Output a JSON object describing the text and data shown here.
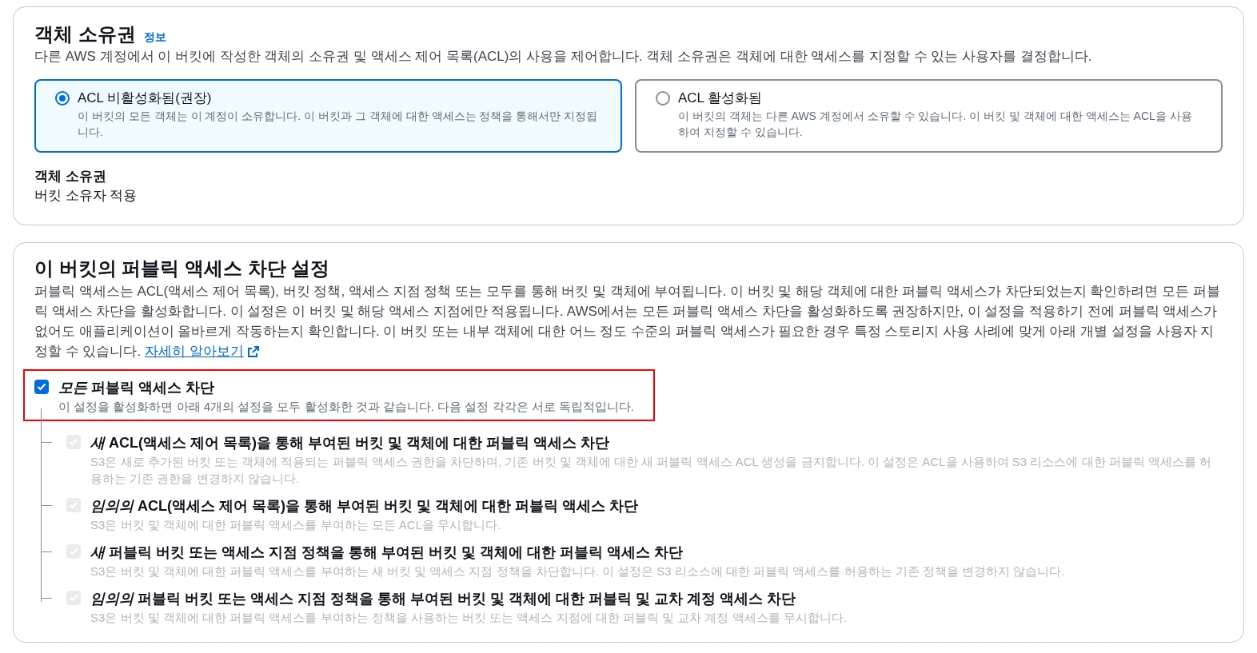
{
  "object_ownership": {
    "title": "객체 소유권",
    "info_link": "정보",
    "description": "다른 AWS 계정에서 이 버킷에 작성한 객체의 소유권 및 액세스 제어 목록(ACL)의 사용을 제어합니다. 객체 소유권은 객체에 대한 액세스를 지정할 수 있는 사용자를 결정합니다.",
    "options": [
      {
        "label": "ACL 비활성화됨(권장)",
        "description": "이 버킷의 모든 객체는 이 계정이 소유합니다. 이 버킷과 그 객체에 대한 액세스는 정책을 통해서만 지정됩니다.",
        "selected": true
      },
      {
        "label": "ACL 활성화됨",
        "description": "이 버킷의 객체는 다른 AWS 계정에서 소유할 수 있습니다. 이 버킷 및 객체에 대한 액세스는 ACL을 사용하여 지정할 수 있습니다.",
        "selected": false
      }
    ],
    "field": {
      "label": "객체 소유권",
      "value": "버킷 소유자 적용"
    }
  },
  "block_public_access": {
    "title": "이 버킷의 퍼블릭 액세스 차단 설정",
    "description": "퍼블릭 액세스는 ACL(액세스 제어 목록), 버킷 정책, 액세스 지점 정책 또는 모두를 통해 버킷 및 객체에 부여됩니다. 이 버킷 및 해당 객체에 대한 퍼블릭 액세스가 차단되었는지 확인하려면 모든 퍼블릭 액세스 차단을 활성화합니다. 이 설정은 이 버킷 및 해당 액세스 지점에만 적용됩니다. AWS에서는 모든 퍼블릭 액세스 차단을 활성화하도록 권장하지만, 이 설정을 적용하기 전에 퍼블릭 액세스가 없어도 애플리케이션이 올바르게 작동하는지 확인합니다. 이 버킷 또는 내부 객체에 대한 어느 정도 수준의 퍼블릭 액세스가 필요한 경우 특정 스토리지 사용 사례에 맞게 아래 개별 설정을 사용자 지정할 수 있습니다.",
    "learn_more": "자세히 알아보기",
    "setting": {
      "label": "*모든* 퍼블릭 액세스 차단",
      "description": "이 설정을 활성화하면 아래 4개의 설정을 모두 활성화한 것과 같습니다. 다음 설정 각각은 서로 독립적입니다.",
      "checked": true,
      "disabled": false,
      "highlighted": true,
      "children": [
        {
          "label": "*새* ACL(액세스 제어 목록)을 통해 부여된 버킷 및 객체에 대한 퍼블릭 액세스 차단",
          "description": "S3은 새로 추가된 버킷 또는 객체에 적용되는 퍼블릭 액세스 권한을 차단하며, 기존 버킷 및 객체에 대한 새 퍼블릭 액세스 ACL 생성을 금지합니다. 이 설정은 ACL을 사용하여 S3 리소스에 대한 퍼블릭 액세스를 허용하는 기존 권한을 변경하지 않습니다.",
          "checked": true,
          "disabled": true
        },
        {
          "label": "*임의의* ACL(액세스 제어 목록)을 통해 부여된 버킷 및 객체에 대한 퍼블릭 액세스 차단",
          "description": "S3은 버킷 및 객체에 대한 퍼블릭 액세스를 부여하는 모든 ACL을 무시합니다.",
          "checked": true,
          "disabled": true
        },
        {
          "label": "*새* 퍼블릭 버킷 또는 액세스 지점 정책을 통해 부여된 버킷 및 객체에 대한 퍼블릭 액세스 차단",
          "description": "S3은 버킷 및 객체에 대한 퍼블릭 액세스를 부여하는 새 버킷 및 액세스 지점 정책을 차단합니다. 이 설정은 S3 리소스에 대한 퍼블릭 액세스를 허용하는 기존 정책을 변경하지 않습니다.",
          "checked": true,
          "disabled": true
        },
        {
          "label": "*임의의* 퍼블릭 버킷 또는 액세스 지점 정책을 통해 부여된 버킷 및 객체에 대한 퍼블릭 및 교차 계정 액세스 차단",
          "description": "S3은 버킷 및 객체에 대한 퍼블릭 액세스를 부여하는 정책을 사용하는 버킷 또는 액세스 지점에 대한 퍼블릭 및 교차 계정 액세스를 무시합니다.",
          "checked": true,
          "disabled": true
        }
      ]
    }
  }
}
